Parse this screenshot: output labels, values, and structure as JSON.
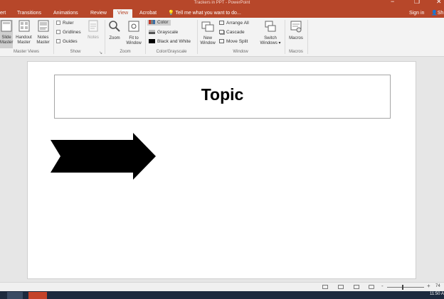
{
  "window": {
    "title": "Trackers in PPT - PowerPoint",
    "controls": [
      "minimize",
      "restore",
      "close"
    ]
  },
  "tabs": [
    {
      "label": "ert",
      "active": false
    },
    {
      "label": "Transitions",
      "active": false
    },
    {
      "label": "Animations",
      "active": false
    },
    {
      "label": "Review",
      "active": false
    },
    {
      "label": "View",
      "active": true
    },
    {
      "label": "Acrobat",
      "active": false
    }
  ],
  "tell_me": {
    "icon": "lightbulb-icon",
    "text": "Tell me what you want to do..."
  },
  "account": {
    "sign_in": "Sign in",
    "share": "Sh"
  },
  "ribbon": {
    "master_views": {
      "buttons": [
        "Slide Master",
        "Handout Master",
        "Notes Master"
      ],
      "slide_master_lines": [
        "Slide",
        "Master"
      ],
      "handout_lines": [
        "Handout",
        "Master"
      ],
      "notes_master_lines": [
        "Notes",
        "Master"
      ],
      "label": "Master Views"
    },
    "show": {
      "ruler": "Ruler",
      "gridlines": "Gridlines",
      "guides": "Guides",
      "notes": "Notes",
      "label": "Show",
      "launcher_icon": "dialog-launcher-icon"
    },
    "zoom": {
      "zoom": "Zoom",
      "fit_lines": [
        "Fit to",
        "Window"
      ],
      "label": "Zoom"
    },
    "color": {
      "color": "Color",
      "grayscale": "Grayscale",
      "black_white": "Black and White",
      "label": "Color/Grayscale"
    },
    "window": {
      "new_window_lines": [
        "New",
        "Window"
      ],
      "arrange_all": "Arrange All",
      "cascade": "Cascade",
      "move_split": "Move Split",
      "switch_lines": [
        "Switch",
        "Windows ▾"
      ],
      "label": "Window"
    },
    "macros": {
      "macros": "Macros",
      "label": "Macros"
    }
  },
  "slide": {
    "title": "Topic",
    "shape": "right-arrow-shape"
  },
  "status_bar": {
    "zoom_minus": "-",
    "zoom_plus": "+",
    "zoom_level": "74"
  },
  "taskbar": {
    "clock": "11:50 A"
  }
}
